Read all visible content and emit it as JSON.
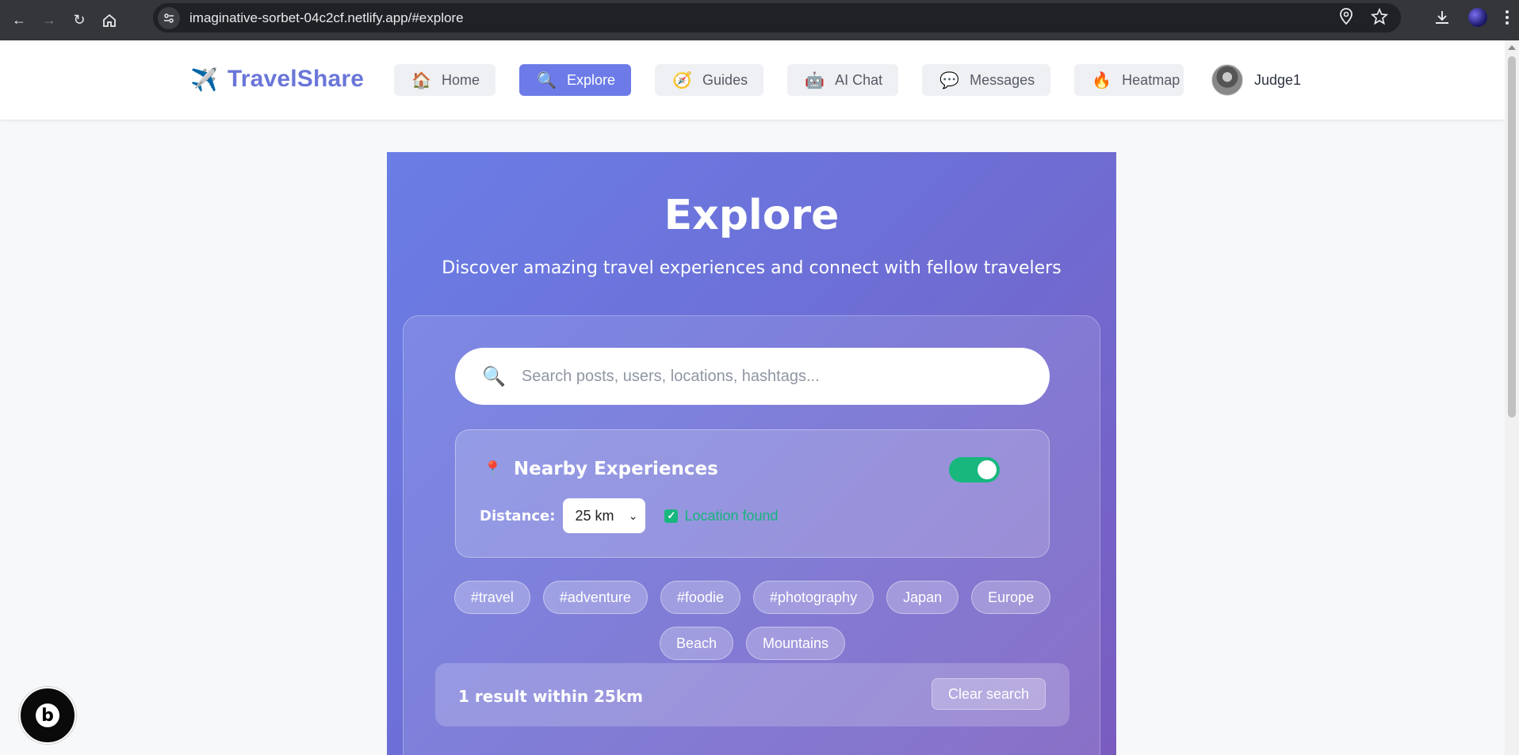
{
  "browser": {
    "url": "imaginative-sorbet-04c2cf.netlify.app/#explore"
  },
  "header": {
    "brand_icon": "✈️",
    "brand_name": "TravelShare",
    "nav": [
      {
        "icon": "🏠",
        "label": "Home"
      },
      {
        "icon": "🔍",
        "label": "Explore"
      },
      {
        "icon": "🧭",
        "label": "Guides"
      },
      {
        "icon": "🤖",
        "label": "AI Chat"
      },
      {
        "icon": "💬",
        "label": "Messages"
      },
      {
        "icon": "🔥",
        "label": "Heatmap"
      }
    ],
    "active_nav": "Explore",
    "username": "Judge1"
  },
  "hero": {
    "title": "Explore",
    "subtitle": "Discover amazing travel experiences and connect with fellow travelers"
  },
  "search": {
    "icon": "🔍",
    "placeholder": "Search posts, users, locations, hashtags..."
  },
  "nearby": {
    "icon": "📍",
    "title": "Nearby Experiences",
    "toggle_on": true,
    "distance_label": "Distance:",
    "distance_value": "25 km",
    "location_status": "Location found",
    "status_color": "#17b37c"
  },
  "tags": [
    "#travel",
    "#adventure",
    "#foodie",
    "#photography",
    "Japan",
    "Europe",
    "Beach",
    "Mountains"
  ],
  "results": {
    "summary": "1 result within 25km",
    "clear_label": "Clear search"
  },
  "colors": {
    "accent": "#6c7be8",
    "brand": "#6a76d8",
    "toggle": "#18b77e"
  }
}
